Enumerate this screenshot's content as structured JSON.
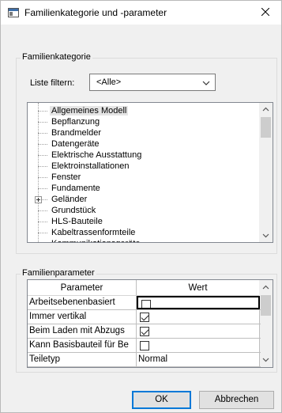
{
  "window": {
    "title": "Familienkategorie und -parameter"
  },
  "category_group": {
    "title": "Familienkategorie",
    "filter_label": "Liste filtern:",
    "filter_value": "<Alle>",
    "tree_items": [
      {
        "label": "Allgemeines Modell",
        "selected": true,
        "expandable": false
      },
      {
        "label": "Bepflanzung",
        "selected": false,
        "expandable": false
      },
      {
        "label": "Brandmelder",
        "selected": false,
        "expandable": false
      },
      {
        "label": "Datengeräte",
        "selected": false,
        "expandable": false
      },
      {
        "label": "Elektrische Ausstattung",
        "selected": false,
        "expandable": false
      },
      {
        "label": "Elektroinstallationen",
        "selected": false,
        "expandable": false
      },
      {
        "label": "Fenster",
        "selected": false,
        "expandable": false
      },
      {
        "label": "Fundamente",
        "selected": false,
        "expandable": false
      },
      {
        "label": "Geländer",
        "selected": false,
        "expandable": true
      },
      {
        "label": "Grundstück",
        "selected": false,
        "expandable": false
      },
      {
        "label": "HLS-Bauteile",
        "selected": false,
        "expandable": false
      },
      {
        "label": "Kabeltrassenformteile",
        "selected": false,
        "expandable": false
      },
      {
        "label": "Kommunikationsgeräte",
        "selected": false,
        "expandable": false
      }
    ]
  },
  "param_group": {
    "title": "Familienparameter",
    "columns": [
      "Parameter",
      "Wert"
    ],
    "rows": [
      {
        "parameter": "Arbeitsebenenbasiert",
        "type": "checkbox",
        "checked": false,
        "active": true
      },
      {
        "parameter": "Immer vertikal",
        "type": "checkbox",
        "checked": true,
        "active": false
      },
      {
        "parameter": "Beim Laden mit Abzugs",
        "type": "checkbox",
        "checked": true,
        "active": false
      },
      {
        "parameter": "Kann Basisbauteil für Be",
        "type": "checkbox",
        "checked": false,
        "active": false
      },
      {
        "parameter": "Teiletyp",
        "type": "text",
        "value": "Normal",
        "active": false
      }
    ]
  },
  "buttons": {
    "ok": "OK",
    "cancel": "Abbrechen"
  },
  "icons": {
    "app": "family-dialog-icon",
    "close": "close-icon",
    "dropdown": "chevron-down-icon",
    "scroll_up": "scroll-up-arrow-icon",
    "scroll_down": "scroll-down-arrow-icon",
    "expand": "plus-expander-icon"
  },
  "colors": {
    "accent": "#0078d7",
    "selection": "#e5e5e5"
  }
}
